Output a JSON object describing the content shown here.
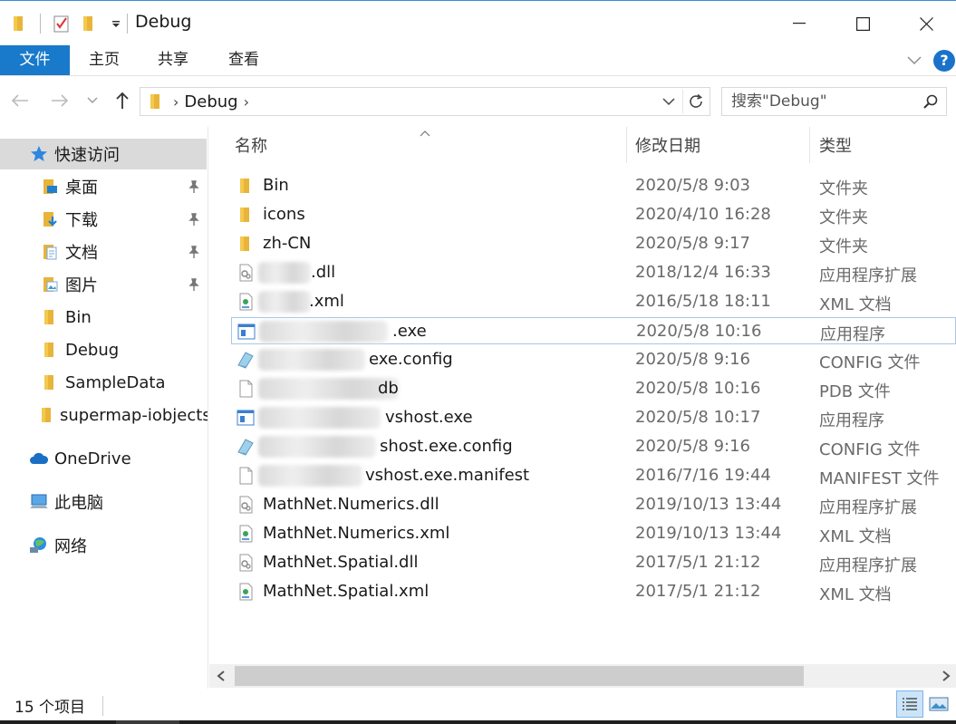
{
  "window": {
    "title": "Debug"
  },
  "ribbon": {
    "tabs": [
      "文件",
      "主页",
      "共享",
      "查看"
    ],
    "help_label": "?"
  },
  "address": {
    "crumb": "Debug",
    "search_placeholder": "搜索\"Debug\""
  },
  "sidebar": {
    "items": [
      {
        "label": "快速访问",
        "icon": "star-icon",
        "selected": true,
        "pinned": false
      },
      {
        "label": "桌面",
        "icon": "desktop-folder-icon",
        "pinned": true
      },
      {
        "label": "下载",
        "icon": "download-folder-icon",
        "pinned": true
      },
      {
        "label": "文档",
        "icon": "documents-folder-icon",
        "pinned": true
      },
      {
        "label": "图片",
        "icon": "pictures-folder-icon",
        "pinned": true
      },
      {
        "label": "Bin",
        "icon": "folder-icon",
        "pinned": false
      },
      {
        "label": "Debug",
        "icon": "folder-icon",
        "pinned": false
      },
      {
        "label": "SampleData",
        "icon": "folder-icon",
        "pinned": false
      },
      {
        "label": "supermap-iobjects",
        "icon": "folder-icon",
        "pinned": false
      },
      {
        "label": "OneDrive",
        "icon": "cloud-icon",
        "pinned": false
      },
      {
        "label": "此电脑",
        "icon": "computer-icon",
        "pinned": false
      },
      {
        "label": "网络",
        "icon": "network-icon",
        "pinned": false
      }
    ]
  },
  "columns": {
    "name": "名称",
    "date": "修改日期",
    "type": "类型"
  },
  "files": [
    {
      "name": "Bin",
      "date": "2020/5/8 9:03",
      "type": "文件夹",
      "icon": "folder-icon"
    },
    {
      "name": "icons",
      "date": "2020/4/10 16:28",
      "type": "文件夹",
      "icon": "folder-icon"
    },
    {
      "name": "zh-CN",
      "date": "2020/5/8 9:17",
      "type": "文件夹",
      "icon": "folder-icon"
    },
    {
      "name": ".dll",
      "date": "2018/12/4 16:33",
      "type": "应用程序扩展",
      "icon": "dll-icon"
    },
    {
      "name": ".xml",
      "date": "2016/5/18 18:11",
      "type": "XML 文档",
      "icon": "xml-icon"
    },
    {
      "name": ".exe",
      "date": "2020/5/8 10:16",
      "type": "应用程序",
      "icon": "exe-icon"
    },
    {
      "name": "exe.config",
      "date": "2020/5/8 9:16",
      "type": "CONFIG 文件",
      "icon": "config-icon"
    },
    {
      "name": "db",
      "date": "2020/5/8 10:16",
      "type": "PDB 文件",
      "icon": "file-icon"
    },
    {
      "name": "vshost.exe",
      "date": "2020/5/8 10:17",
      "type": "应用程序",
      "icon": "exe-icon"
    },
    {
      "name": "shost.exe.config",
      "date": "2020/5/8 9:16",
      "type": "CONFIG 文件",
      "icon": "config-icon"
    },
    {
      "name": "vshost.exe.manifest",
      "date": "2016/7/16 19:44",
      "type": "MANIFEST 文件",
      "icon": "file-icon"
    },
    {
      "name": "MathNet.Numerics.dll",
      "date": "2019/10/13 13:44",
      "type": "应用程序扩展",
      "icon": "dll-icon"
    },
    {
      "name": "MathNet.Numerics.xml",
      "date": "2019/10/13 13:44",
      "type": "XML 文档",
      "icon": "xml-icon"
    },
    {
      "name": "MathNet.Spatial.dll",
      "date": "2017/5/1 21:12",
      "type": "应用程序扩展",
      "icon": "dll-icon"
    },
    {
      "name": "MathNet.Spatial.xml",
      "date": "2017/5/1 21:12",
      "type": "XML 文档",
      "icon": "xml-icon"
    }
  ],
  "status": {
    "count": "15 个项目"
  }
}
